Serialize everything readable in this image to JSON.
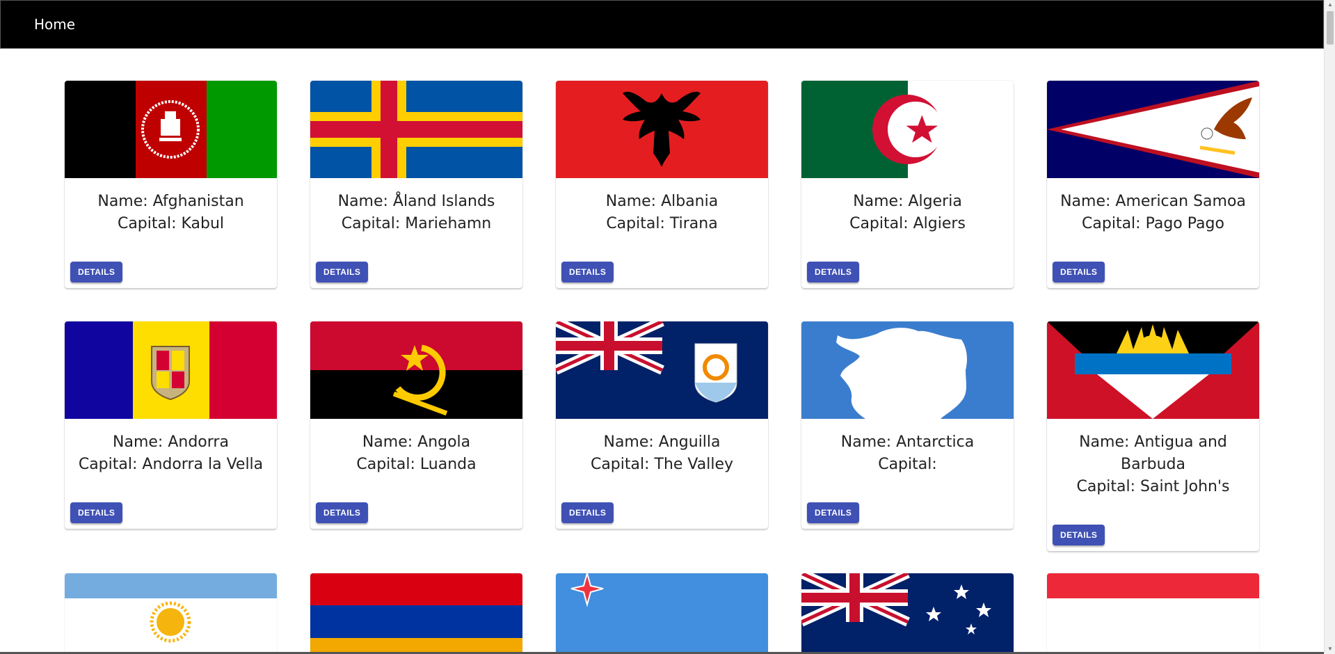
{
  "nav": {
    "home_label": "Home"
  },
  "card_button_label": "DETAILS",
  "countries": [
    {
      "name": "Name: Afghanistan",
      "capital": "Capital: Kabul"
    },
    {
      "name": "Name: Åland Islands",
      "capital": "Capital: Mariehamn"
    },
    {
      "name": "Name: Albania",
      "capital": "Capital: Tirana"
    },
    {
      "name": "Name: Algeria",
      "capital": "Capital: Algiers"
    },
    {
      "name": "Name: American Samoa",
      "capital": "Capital: Pago Pago"
    },
    {
      "name": "Name: Andorra",
      "capital": "Capital: Andorra la Vella"
    },
    {
      "name": "Name: Angola",
      "capital": "Capital: Luanda"
    },
    {
      "name": "Name: Anguilla",
      "capital": "Capital: The Valley"
    },
    {
      "name": "Name: Antarctica",
      "capital": "Capital:"
    },
    {
      "name": "Name: Antigua and Barbuda",
      "capital": "Capital: Saint John's"
    }
  ],
  "colors": {
    "navbar": "#000000",
    "button": "#3f51b5"
  }
}
